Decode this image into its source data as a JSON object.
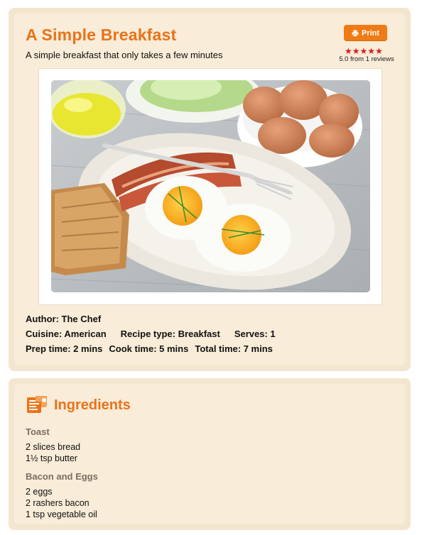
{
  "recipe": {
    "title": "A Simple Breakfast",
    "subtitle": "A simple breakfast that only takes a few minutes",
    "print_label": "Print",
    "rating_stars": 5,
    "rating_text": "5.0 from 1 reviews",
    "author": "Author: The Chef",
    "cuisine": "Cuisine: American",
    "recipe_type": "Recipe type: Breakfast",
    "serves": "Serves: 1",
    "prep_time": "Prep time:  2 mins",
    "cook_time": "Cook time:  5 mins",
    "total_time": "Total time:  7 mins"
  },
  "ingredients": {
    "title": "Ingredients",
    "groups": [
      {
        "name": "Toast",
        "items": [
          "2 slices bread",
          "1½ tsp butter"
        ]
      },
      {
        "name": "Bacon and Eggs",
        "items": [
          "2 eggs",
          "2 rashers bacon",
          "1 tsp vegetable oil"
        ]
      }
    ]
  },
  "colors": {
    "accent": "#e8731a",
    "button": "#f07a14",
    "stars": "#d81d1d",
    "card_bg": "#f9ecd8",
    "card_border": "#f3e6cf",
    "group_title": "#7a6e62"
  },
  "icons": {
    "print": "printer-icon",
    "ingredients": "ingredients-icon",
    "star": "star-icon"
  }
}
